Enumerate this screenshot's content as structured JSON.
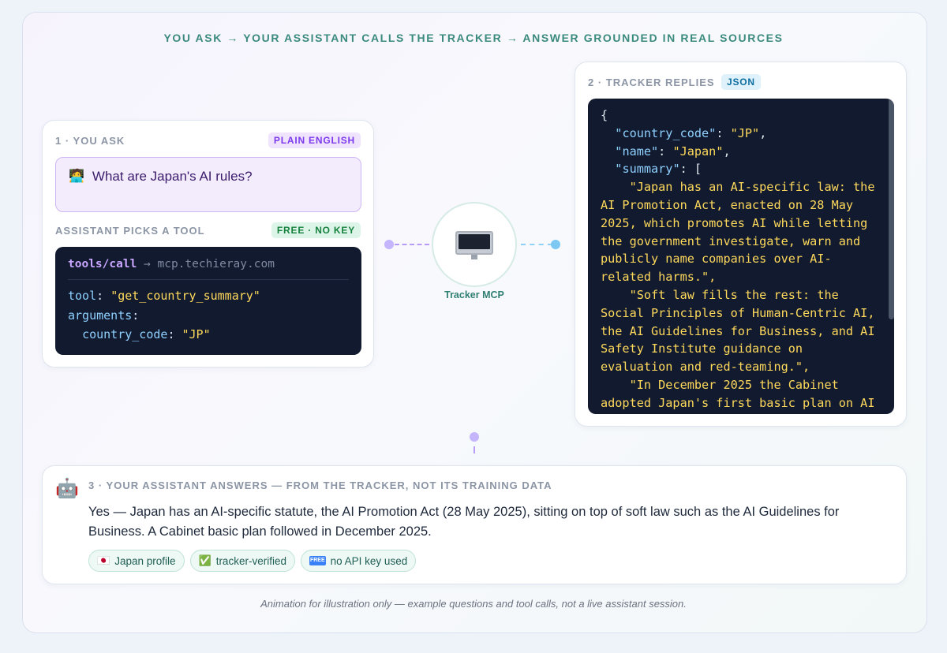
{
  "headline": "YOU ASK → YOUR ASSISTANT CALLS THE TRACKER → ANSWER GROUNDED IN REAL SOURCES",
  "ask_card": {
    "step_label": "1 · YOU ASK",
    "badge": "PLAIN ENGLISH",
    "question_icon": "person-at-laptop-icon",
    "question": "What are Japan's AI rules?",
    "tool_label": "ASSISTANT PICKS A TOOL",
    "tool_badge": "FREE · NO KEY",
    "call": {
      "method": "tools/call",
      "arrow": "→",
      "host": "mcp.techieray.com",
      "tool_key": "tool",
      "tool_value": "\"get_country_summary\"",
      "arguments_key": "arguments",
      "country_code_key": "country_code",
      "country_code_value": "\"JP\""
    }
  },
  "mcp": {
    "label": "Tracker MCP",
    "icon": "computer-monitor-icon"
  },
  "reply_card": {
    "step_label": "2 · TRACKER REPLIES",
    "badge": "JSON",
    "json": {
      "open_brace": "{",
      "country_code_key": "\"country_code\"",
      "country_code_value": "\"JP\"",
      "name_key": "\"name\"",
      "name_value": "\"Japan\"",
      "summary_key": "\"summary\"",
      "summary_items": [
        "\"Japan has an AI-specific law: the AI Promotion Act, enacted on 28 May 2025, which promotes AI while letting the government investigate, warn and publicly name companies over AI-related harms.\",",
        "\"Soft law fills the rest: the Social Principles of Human-Centric AI, the AI Guidelines for Business, and AI Safety Institute guidance on evaluation and red-teaming.\",",
        "\"In December 2025 the Cabinet adopted Japan's first basic plan on AI"
      ]
    }
  },
  "answer_card": {
    "robot_icon": "robot-icon",
    "step_label": "3 · YOUR ASSISTANT ANSWERS — FROM THE TRACKER, NOT ITS TRAINING DATA",
    "answer": "Yes — Japan has an AI-specific statute, the AI Promotion Act (28 May 2025), sitting on top of soft law such as the AI Guidelines for Business. A Cabinet basic plan followed in December 2025.",
    "chips": [
      {
        "icon": "japan-flag-icon",
        "glyph": "🇯🇵",
        "label": "Japan profile"
      },
      {
        "icon": "check-mark-icon",
        "glyph": "✅",
        "label": "tracker-verified"
      },
      {
        "icon": "free-icon",
        "glyph": "FREE",
        "label": "no API key used"
      }
    ]
  },
  "footnote": "Animation for illustration only — example questions and tool calls, not a live assistant session.",
  "colors": {
    "accent_teal": "#3b8a7e",
    "purple": "#7c3aed",
    "green": "#15803d",
    "blue": "#0e6fa0",
    "code_bg": "#111a2e",
    "code_string": "#ffd95c",
    "code_key": "#8fd0ff"
  }
}
